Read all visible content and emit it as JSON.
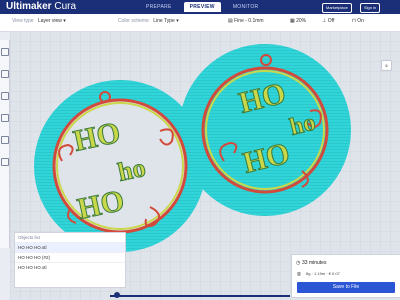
{
  "topbar": {
    "brand_bold": "Ultimaker",
    "brand_light": " Cura",
    "stages": [
      "PREPARE",
      "PREVIEW",
      "MONITOR"
    ],
    "active_stage": "PREVIEW",
    "marketplace": "Marketplace",
    "signin": "Sign in"
  },
  "appbar": {
    "view_type_label": "View type",
    "view_type_value": "Layer view",
    "color_scheme_label": "Color scheme",
    "color_scheme_value": "Line Type",
    "profile": "Fine - 0.1mm",
    "infill": "20%",
    "support": "Off",
    "adhesion": "On"
  },
  "scene": {
    "left_text_top": "HO",
    "left_text_mid": "ho",
    "left_text_bottom": "HO",
    "right_text_top": "HO",
    "right_text_mid": "ho",
    "right_text_bottom": "HO"
  },
  "objects": {
    "header": "Objects list",
    "rows": [
      "HO HO HO.stl",
      "HO HO HO (#2)",
      "HO HO HO.stl"
    ]
  },
  "job": {
    "time": "33 minutes",
    "cost": "8g · 1.19m · € 0.07",
    "save": "Save to File"
  },
  "side": {
    "layer": "6"
  },
  "colors": {
    "brand": "#1b2f78",
    "shell": "#2fd5d8",
    "infill": "#c9d84a",
    "wall": "#d24a3b",
    "accent": "#2a56d6"
  }
}
